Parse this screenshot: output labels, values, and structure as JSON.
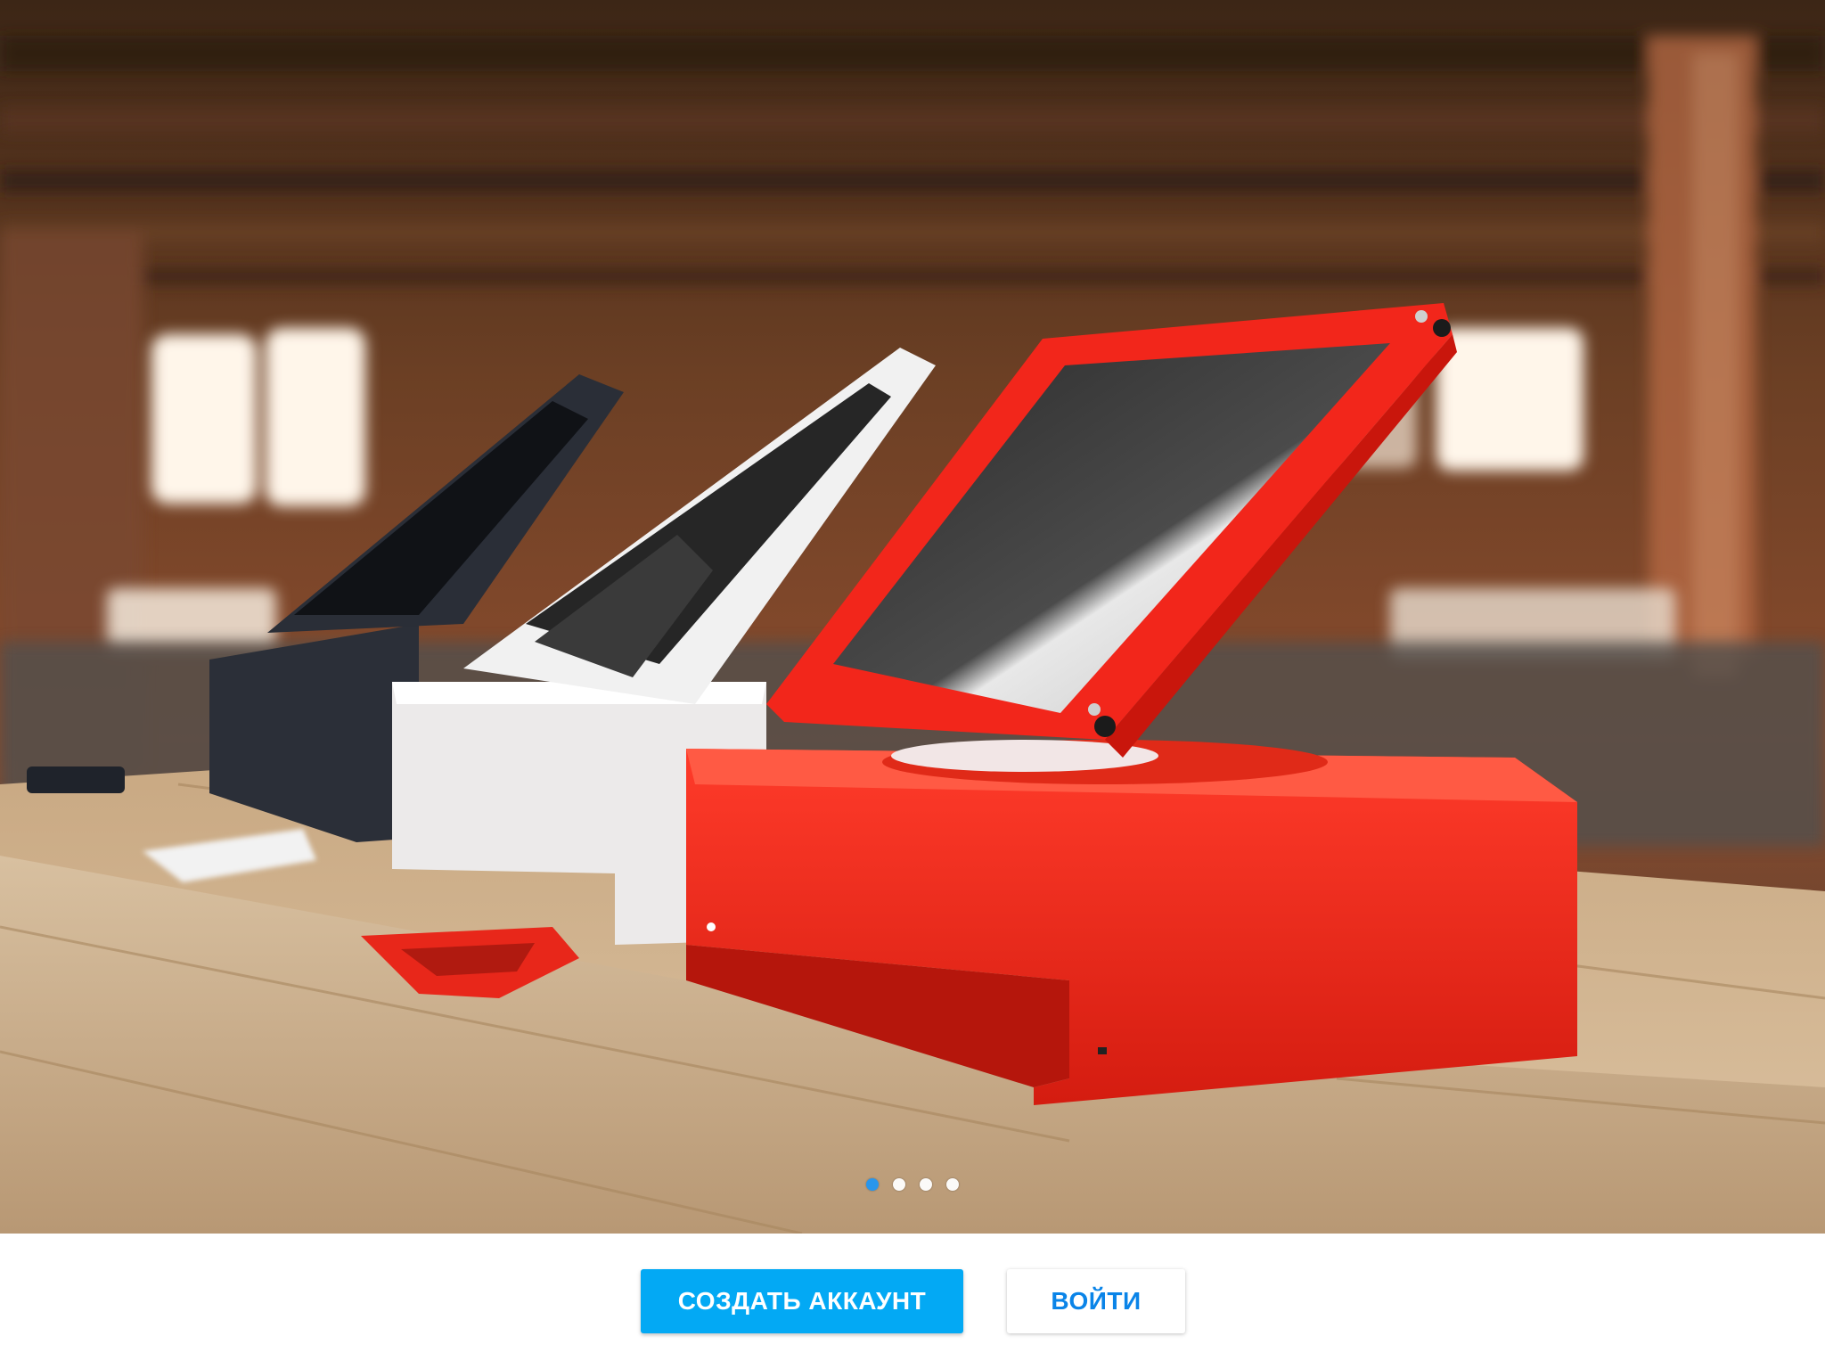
{
  "carousel": {
    "image_description_icon": "photo-carousel",
    "active_slide": 1,
    "slides": [
      1,
      2,
      3,
      4
    ],
    "colors": {
      "active": "#2196f3",
      "inactive": "#ffffff"
    }
  },
  "actions": {
    "create_account": "СОЗДАТЬ АККАУНТ",
    "login": "ВОЙТИ",
    "colors": {
      "primary": "#03a9f4",
      "secondary_text": "#0a84e8"
    }
  }
}
